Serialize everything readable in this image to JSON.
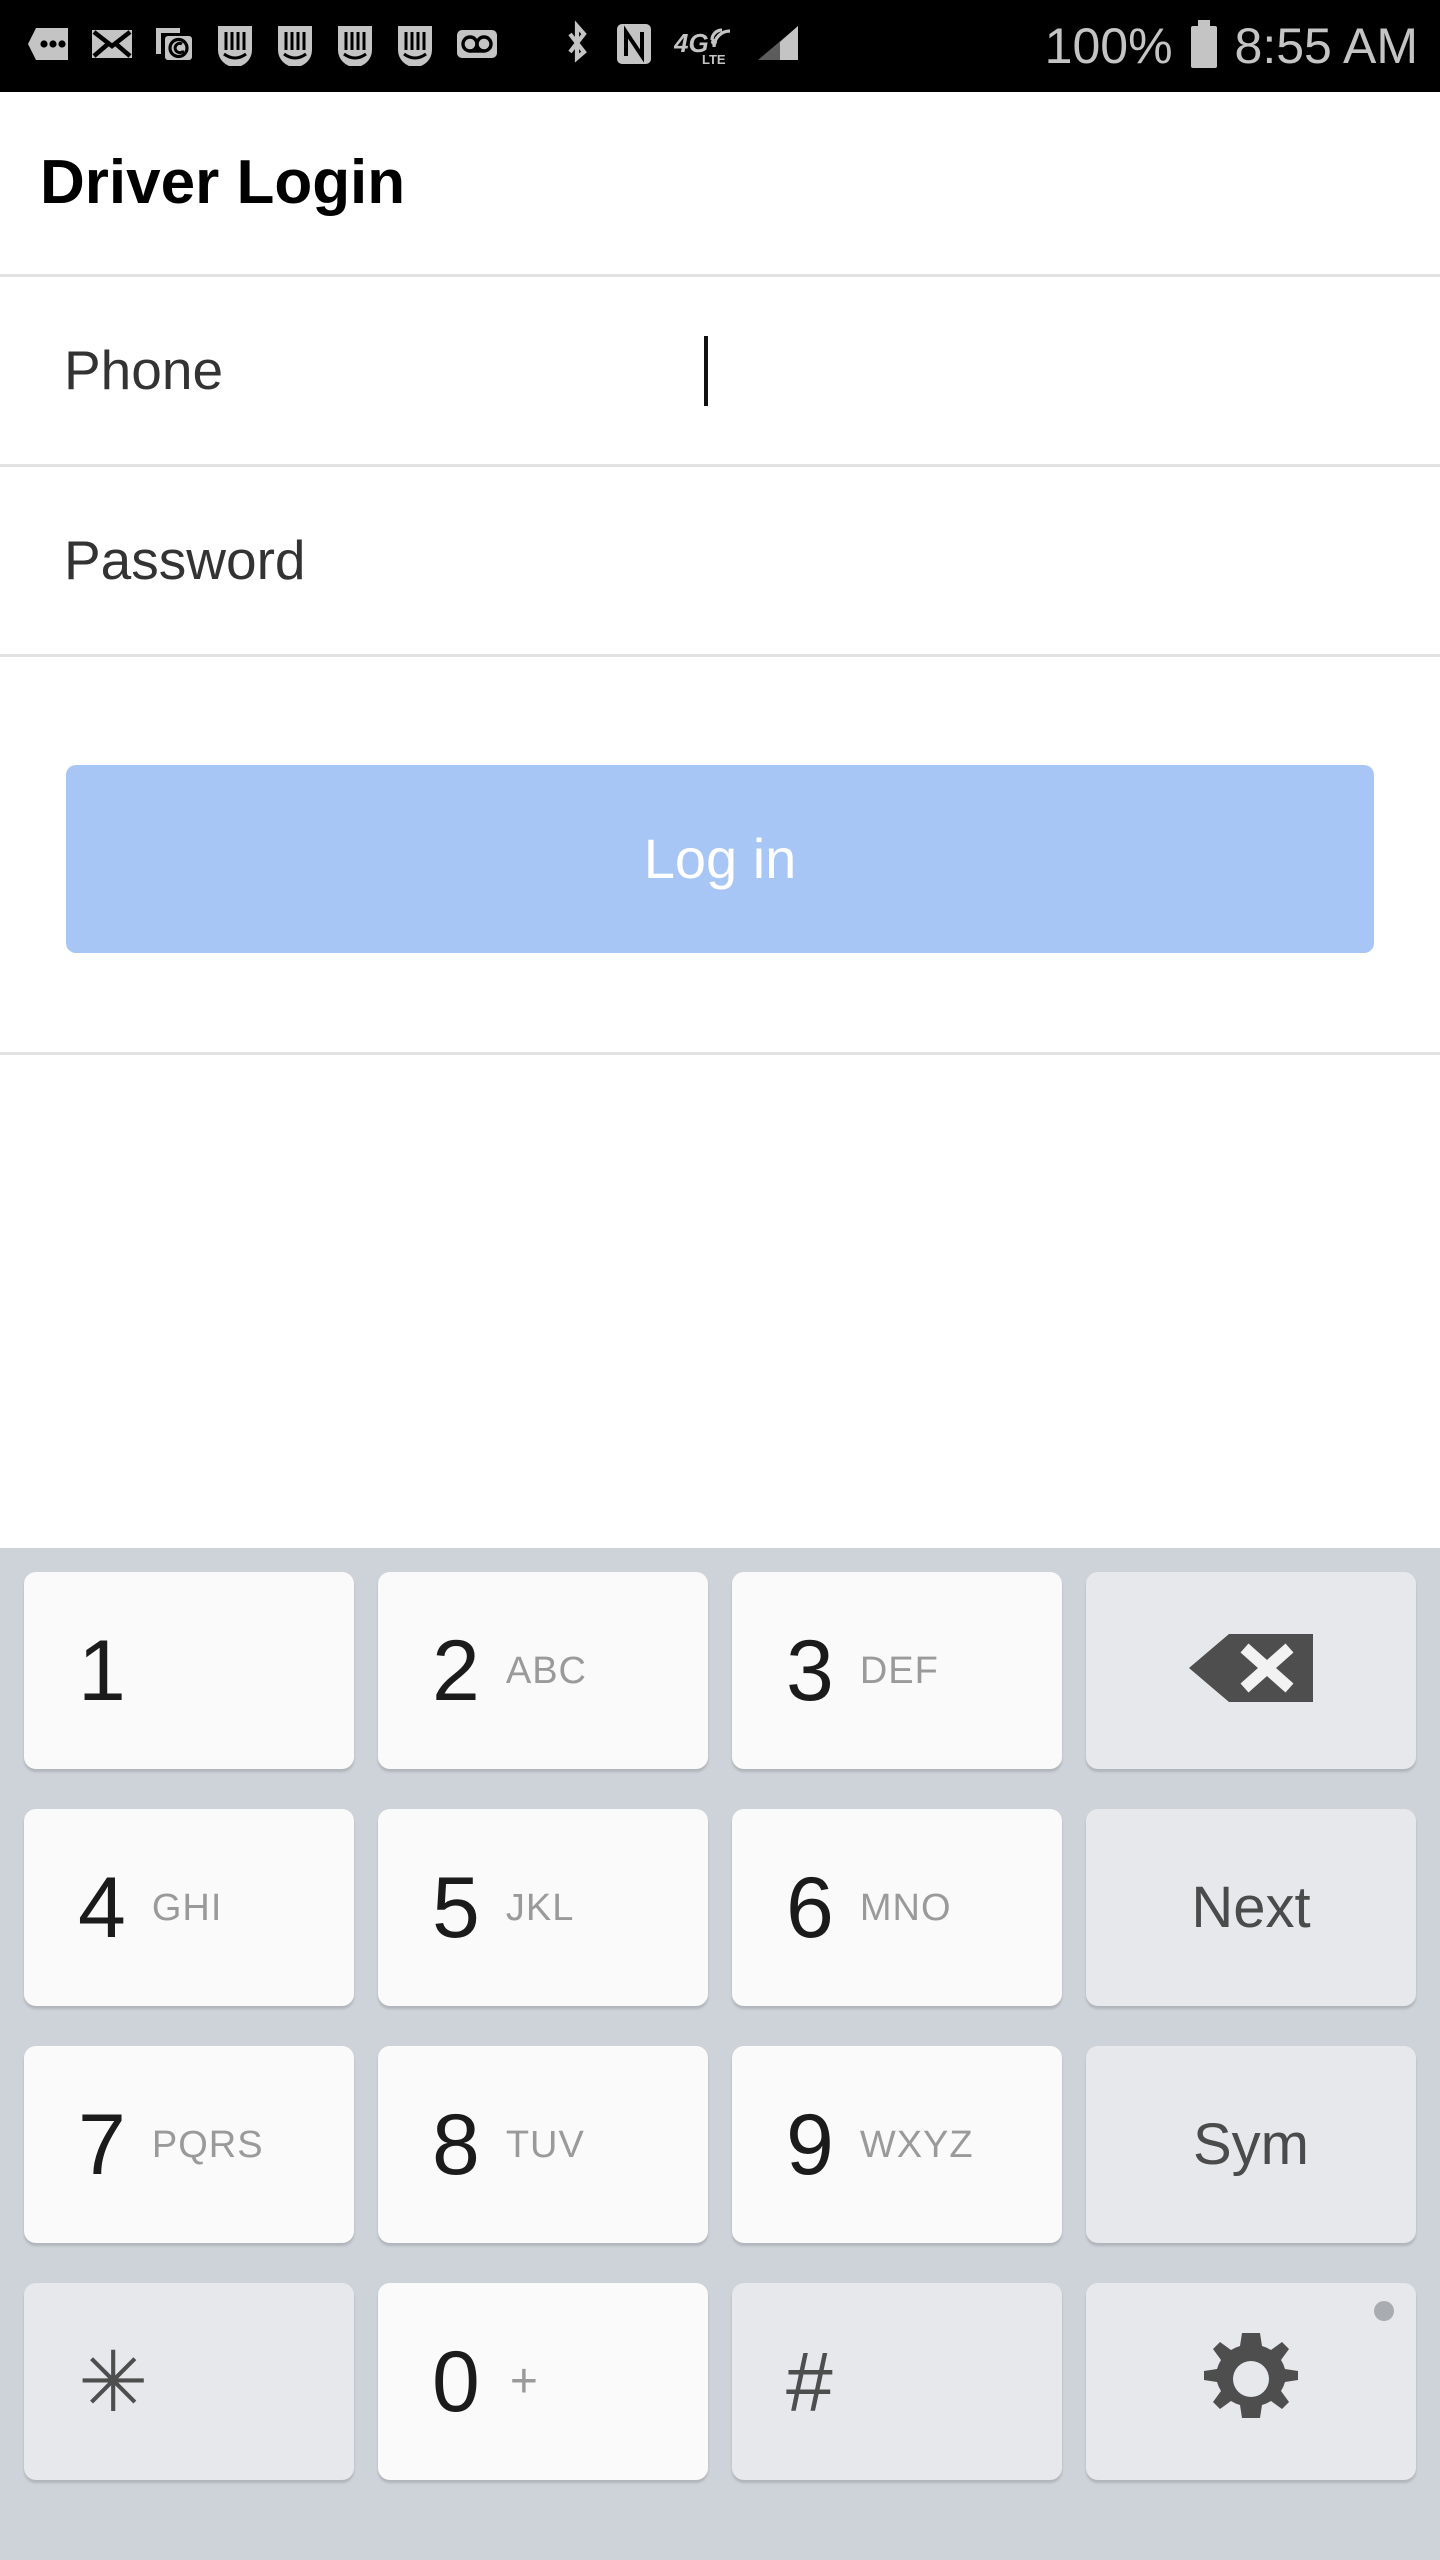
{
  "status_bar": {
    "battery_percent": "100%",
    "time": "8:55 AM",
    "icons": [
      "more-messages-icon",
      "email-icon",
      "screenshot-capture-icon",
      "sim-card-icon-1",
      "sim-card-icon-2",
      "sim-card-icon-3",
      "sim-card-icon-4",
      "voicemail-icon",
      "bluetooth-icon",
      "nfc-icon",
      "network-4g-lte-icon",
      "signal-bars-icon",
      "battery-icon"
    ],
    "background": "#000000",
    "foreground": "#c4c4c4"
  },
  "header": {
    "title": "Driver Login"
  },
  "form": {
    "phone": {
      "label": "Phone",
      "value": "",
      "placeholder": "",
      "focused": true
    },
    "password": {
      "label": "Password",
      "value": "",
      "placeholder": "",
      "focused": false
    },
    "login_button": {
      "label": "Log in",
      "background": "#a8c6f5",
      "text_color": "#ffffff"
    }
  },
  "keyboard": {
    "background": "#ced3d9",
    "key_light": "#fafafa",
    "key_function": "#e6e8eb",
    "rows": [
      [
        {
          "digit": "1",
          "letters": "",
          "type": "digit"
        },
        {
          "digit": "2",
          "letters": "ABC",
          "type": "digit"
        },
        {
          "digit": "3",
          "letters": "DEF",
          "type": "digit"
        },
        {
          "digit": "",
          "letters": "",
          "type": "backspace",
          "name": "backspace-key"
        }
      ],
      [
        {
          "digit": "4",
          "letters": "GHI",
          "type": "digit"
        },
        {
          "digit": "5",
          "letters": "JKL",
          "type": "digit"
        },
        {
          "digit": "6",
          "letters": "MNO",
          "type": "digit"
        },
        {
          "digit": "",
          "letters": "",
          "type": "label",
          "label": "Next",
          "name": "next-key"
        }
      ],
      [
        {
          "digit": "7",
          "letters": "PQRS",
          "type": "digit"
        },
        {
          "digit": "8",
          "letters": "TUV",
          "type": "digit"
        },
        {
          "digit": "9",
          "letters": "WXYZ",
          "type": "digit"
        },
        {
          "digit": "",
          "letters": "",
          "type": "label",
          "label": "Sym",
          "name": "sym-key"
        }
      ],
      [
        {
          "digit": "",
          "letters": "",
          "type": "symbol",
          "label": "✳",
          "name": "asterisk-key"
        },
        {
          "digit": "0",
          "letters": "",
          "type": "digit",
          "plus": "+"
        },
        {
          "digit": "",
          "letters": "",
          "type": "symbol",
          "label": "#",
          "name": "hash-key"
        },
        {
          "digit": "",
          "letters": "",
          "type": "gear",
          "name": "keyboard-settings-key"
        }
      ]
    ]
  }
}
